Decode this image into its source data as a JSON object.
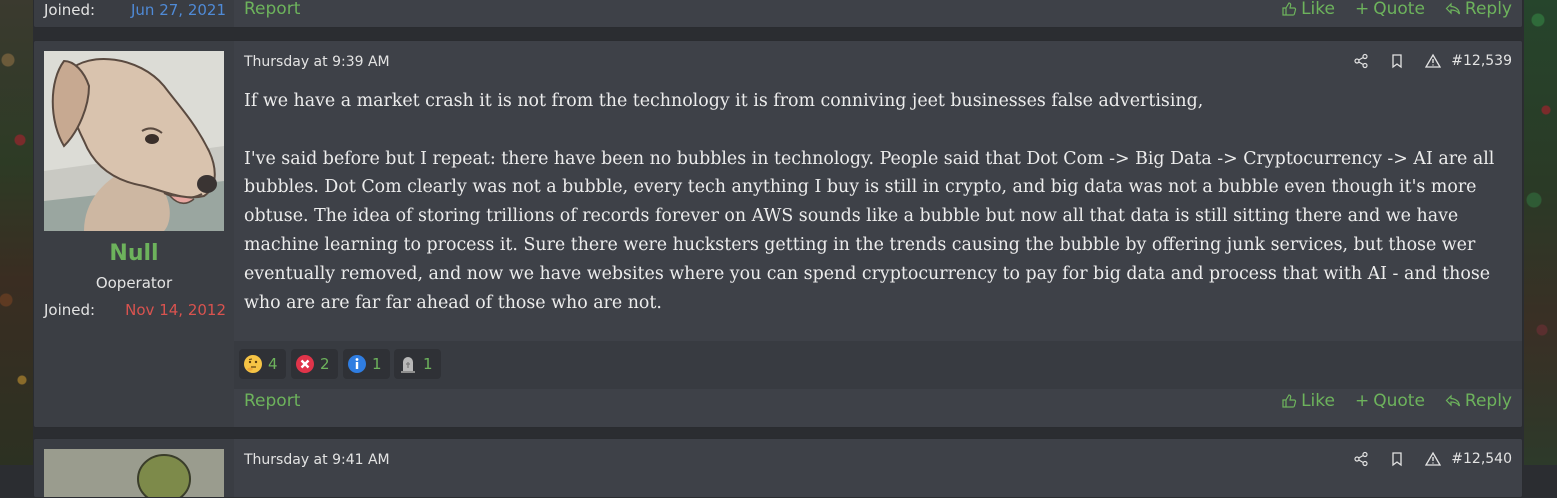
{
  "colors": {
    "accent_green": "#6db35c",
    "joined_date_red": "#d9534f",
    "joined_date_blue": "#4f8ad6"
  },
  "prev_post": {
    "joined_label": "Joined:",
    "joined_date": "Jun 27, 2021",
    "report": "Report",
    "like": "Like",
    "quote": "Quote",
    "reply": "Reply"
  },
  "post": {
    "username": "Null",
    "user_title": "Ooperator",
    "joined_label": "Joined:",
    "joined_date": "Nov 14, 2012",
    "date": "Thursday at 9:39 AM",
    "number": "#12,539",
    "tool_icons": [
      "share-icon",
      "bookmark-icon",
      "warning-icon"
    ],
    "message": [
      "If we have a market crash it is not from the technology it is from conniving jeet businesses false advertising,",
      "I've said before but I repeat: there have been no bubbles in technology. People said that Dot Com -> Big Data -> Cryptocurrency -> AI are all bubbles. Dot Com clearly was not a bubble, every tech anything I buy is still in crypto, and big data was not a bubble even though it's more obtuse. The idea of storing trillions of records forever on AWS sounds like a bubble but now all that data is still sitting there and we have machine learning to process it. Sure there were hucksters getting in the trends causing the bubble by offering junk services, but those wer eventually removed, and now we have websites where you can spend cryptocurrency to pay for big data and process that with AI - and those who are are far far ahead of those who are not."
    ],
    "reactions": [
      {
        "icon": "thinking-face-icon",
        "count": "4"
      },
      {
        "icon": "red-x-icon",
        "count": "2"
      },
      {
        "icon": "info-icon",
        "count": "1"
      },
      {
        "icon": "tombstone-icon",
        "count": "1"
      }
    ],
    "report": "Report",
    "like": "Like",
    "quote": "Quote",
    "reply": "Reply"
  },
  "next_post": {
    "date": "Thursday at 9:41 AM",
    "number": "#12,540"
  }
}
